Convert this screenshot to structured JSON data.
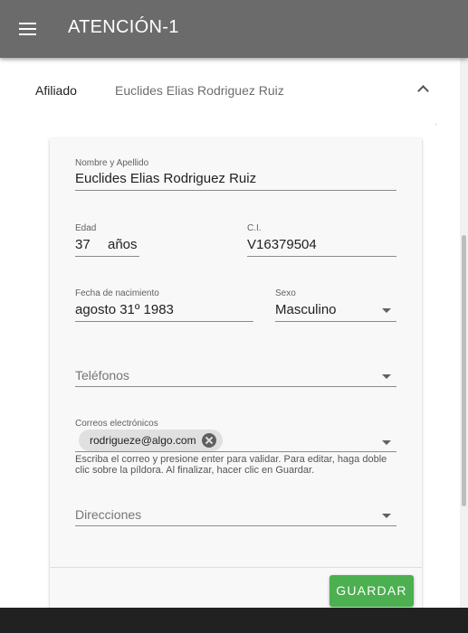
{
  "app": {
    "title": "ATENCIÓN-1"
  },
  "panel": {
    "label": "Afiliado",
    "value": "Euclides Elias Rodriguez Ruiz"
  },
  "form": {
    "nombre": {
      "label": "Nombre y Apellido",
      "value": "Euclides Elias Rodriguez Ruiz"
    },
    "edad": {
      "label": "Edad",
      "value": "37",
      "suffix": "años"
    },
    "ci": {
      "label": "C.I.",
      "value": "V16379504"
    },
    "fecha": {
      "label": "Fecha de nacimiento",
      "value": "agosto 31º 1983"
    },
    "sexo": {
      "label": "Sexo",
      "value": "Masculino"
    },
    "telefonos": {
      "placeholder": "Teléfonos"
    },
    "correos": {
      "label": "Correos electrónicos",
      "chips": [
        "rodrigueze@algo.com"
      ],
      "hint": "Escriba el correo y presione enter para validar. Para editar, haga doble clic sobre la píldora. Al finalizar, hacer clic en Guardar."
    },
    "direcciones": {
      "placeholder": "Direcciones"
    }
  },
  "actions": {
    "save_label": "GUARDAR"
  },
  "icons": {
    "menu": "menu-icon",
    "collapse": "chevron-up-icon",
    "dropdown": "arrow-drop-down-icon",
    "remove": "cancel-icon"
  },
  "colors": {
    "toolbar": "#6b6b6b",
    "save": "#4caf50"
  }
}
